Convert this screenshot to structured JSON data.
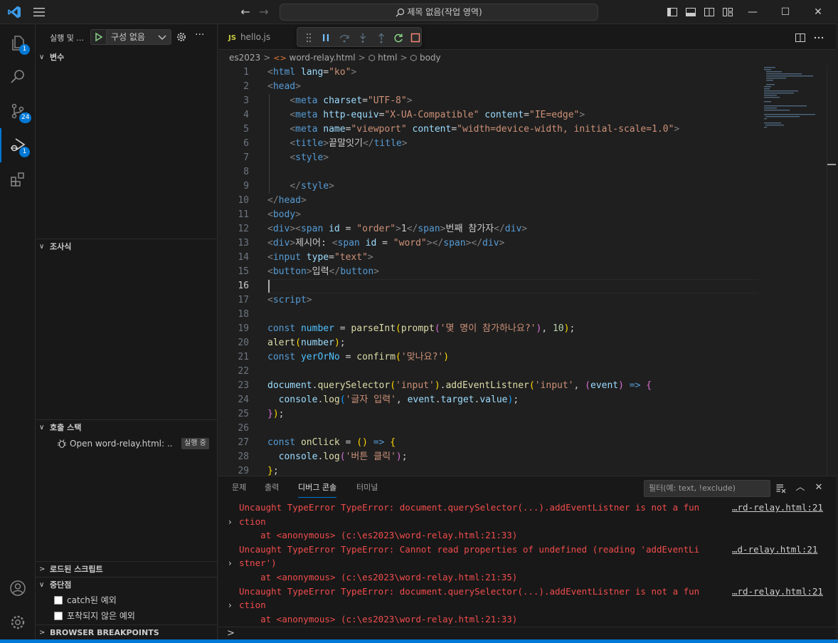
{
  "titlebar": {
    "search_label": "제목 없음(작업 영역)",
    "window_controls": [
      "minimize",
      "maximize",
      "close"
    ]
  },
  "activity": {
    "explorer_badge": "1",
    "scm_badge": "24",
    "debug_badge": "1"
  },
  "sidebar": {
    "title": "실행 및 ...",
    "config_label": "구성 없음",
    "variables_label": "변수",
    "watch_label": "조사식",
    "callstack_label": "호출 스택",
    "callstack_item": "Open word-relay.html: ...",
    "callstack_state": "실행 중",
    "loaded_scripts_label": "로드된 스크립트",
    "breakpoints_label": "중단점",
    "bp_caught": "catch된 예외",
    "bp_uncaught": "포착되지 않은 예외",
    "browser_breakpoints_label": "BROWSER BREAKPOINTS"
  },
  "editor": {
    "tab_icon": "JS",
    "tab_label": "hello.js",
    "breadcrumb": [
      "es2023",
      "word-relay.html",
      "html",
      "body"
    ],
    "line_numbers": [
      "1",
      "2",
      "3",
      "4",
      "5",
      "6",
      "7",
      "8",
      "9",
      "10",
      "11",
      "12",
      "13",
      "14",
      "15",
      "16",
      "17",
      "18",
      "19",
      "20",
      "21",
      "22",
      "23",
      "24",
      "25",
      "26",
      "27",
      "28",
      "29"
    ],
    "code": [
      [
        [
          "<",
          "p"
        ],
        [
          "html",
          "t"
        ],
        [
          " ",
          "w"
        ],
        [
          "lang",
          "a"
        ],
        [
          "=",
          "w"
        ],
        [
          "\"ko\"",
          "s"
        ],
        [
          ">",
          "p"
        ]
      ],
      [
        [
          "<",
          "p"
        ],
        [
          "head",
          "t"
        ],
        [
          ">",
          "p"
        ]
      ],
      [
        [
          "    ",
          "w"
        ],
        [
          "<",
          "p"
        ],
        [
          "meta",
          "t"
        ],
        [
          " ",
          "w"
        ],
        [
          "charset",
          "a"
        ],
        [
          "=",
          "w"
        ],
        [
          "\"UTF-8\"",
          "s"
        ],
        [
          ">",
          "p"
        ]
      ],
      [
        [
          "    ",
          "w"
        ],
        [
          "<",
          "p"
        ],
        [
          "meta",
          "t"
        ],
        [
          " ",
          "w"
        ],
        [
          "http-equiv",
          "a"
        ],
        [
          "=",
          "w"
        ],
        [
          "\"X-UA-Compatible\"",
          "s"
        ],
        [
          " ",
          "w"
        ],
        [
          "content",
          "a"
        ],
        [
          "=",
          "w"
        ],
        [
          "\"IE=edge\"",
          "s"
        ],
        [
          ">",
          "p"
        ]
      ],
      [
        [
          "    ",
          "w"
        ],
        [
          "<",
          "p"
        ],
        [
          "meta",
          "t"
        ],
        [
          " ",
          "w"
        ],
        [
          "name",
          "a"
        ],
        [
          "=",
          "w"
        ],
        [
          "\"viewport\"",
          "s"
        ],
        [
          " ",
          "w"
        ],
        [
          "content",
          "a"
        ],
        [
          "=",
          "w"
        ],
        [
          "\"width=device-width, initial-scale=1.0\"",
          "s"
        ],
        [
          ">",
          "p"
        ]
      ],
      [
        [
          "    ",
          "w"
        ],
        [
          "<",
          "p"
        ],
        [
          "title",
          "t"
        ],
        [
          ">",
          "p"
        ],
        [
          "끝말잇기",
          "w"
        ],
        [
          "</",
          "p"
        ],
        [
          "title",
          "t"
        ],
        [
          ">",
          "p"
        ]
      ],
      [
        [
          "    ",
          "w"
        ],
        [
          "<",
          "p"
        ],
        [
          "style",
          "t"
        ],
        [
          ">",
          "p"
        ]
      ],
      [
        [
          "",
          "w"
        ]
      ],
      [
        [
          "    ",
          "w"
        ],
        [
          "</",
          "p"
        ],
        [
          "style",
          "t"
        ],
        [
          ">",
          "p"
        ]
      ],
      [
        [
          "</",
          "p"
        ],
        [
          "head",
          "t"
        ],
        [
          ">",
          "p"
        ]
      ],
      [
        [
          "<",
          "p"
        ],
        [
          "body",
          "t"
        ],
        [
          ">",
          "p"
        ]
      ],
      [
        [
          "<",
          "p"
        ],
        [
          "div",
          "t"
        ],
        [
          ">",
          "p"
        ],
        [
          "<",
          "p"
        ],
        [
          "span",
          "t"
        ],
        [
          " ",
          "w"
        ],
        [
          "id",
          "a"
        ],
        [
          " = ",
          "w"
        ],
        [
          "\"order\"",
          "s"
        ],
        [
          ">",
          "p"
        ],
        [
          "1",
          "w"
        ],
        [
          "</",
          "p"
        ],
        [
          "span",
          "t"
        ],
        [
          ">",
          "p"
        ],
        [
          "번째 참가자",
          "w"
        ],
        [
          "</",
          "p"
        ],
        [
          "div",
          "t"
        ],
        [
          ">",
          "p"
        ]
      ],
      [
        [
          "<",
          "p"
        ],
        [
          "div",
          "t"
        ],
        [
          ">",
          "p"
        ],
        [
          "제시어: ",
          "w"
        ],
        [
          "<",
          "p"
        ],
        [
          "span",
          "t"
        ],
        [
          " ",
          "w"
        ],
        [
          "id",
          "a"
        ],
        [
          " = ",
          "w"
        ],
        [
          "\"word\"",
          "s"
        ],
        [
          ">",
          "p"
        ],
        [
          "</",
          "p"
        ],
        [
          "span",
          "t"
        ],
        [
          ">",
          "p"
        ],
        [
          "</",
          "p"
        ],
        [
          "div",
          "t"
        ],
        [
          ">",
          "p"
        ]
      ],
      [
        [
          "<",
          "p"
        ],
        [
          "input",
          "t"
        ],
        [
          " ",
          "w"
        ],
        [
          "type",
          "a"
        ],
        [
          "=",
          "w"
        ],
        [
          "\"text\"",
          "s"
        ],
        [
          ">",
          "p"
        ]
      ],
      [
        [
          "<",
          "p"
        ],
        [
          "button",
          "t"
        ],
        [
          ">",
          "p"
        ],
        [
          "입력",
          "w"
        ],
        [
          "</",
          "p"
        ],
        [
          "button",
          "t"
        ],
        [
          ">",
          "p"
        ]
      ],
      [
        [
          "",
          "w"
        ]
      ],
      [
        [
          "<",
          "p"
        ],
        [
          "script",
          "t"
        ],
        [
          ">",
          "p"
        ]
      ],
      [
        [
          "",
          "w"
        ]
      ],
      [
        [
          "const",
          "k"
        ],
        [
          " ",
          "w"
        ],
        [
          "number",
          "v"
        ],
        [
          " = ",
          "w"
        ],
        [
          "parseInt",
          "f"
        ],
        [
          "(",
          "y"
        ],
        [
          "prompt",
          "f"
        ],
        [
          "(",
          "m"
        ],
        [
          "'몇 명이 참가하나요?'",
          "s"
        ],
        [
          ")",
          "m"
        ],
        [
          ", ",
          "w"
        ],
        [
          "10",
          "n"
        ],
        [
          ")",
          "y"
        ],
        [
          ";",
          "w"
        ]
      ],
      [
        [
          "alert",
          "f"
        ],
        [
          "(",
          "y"
        ],
        [
          "number",
          "a"
        ],
        [
          ")",
          "y"
        ],
        [
          ";",
          "w"
        ]
      ],
      [
        [
          "const",
          "k"
        ],
        [
          " ",
          "w"
        ],
        [
          "yerOrNo",
          "v"
        ],
        [
          " = ",
          "w"
        ],
        [
          "confirm",
          "f"
        ],
        [
          "(",
          "y"
        ],
        [
          "'맞나요?'",
          "s"
        ],
        [
          ")",
          "y"
        ]
      ],
      [
        [
          "",
          "w"
        ]
      ],
      [
        [
          "document",
          "a"
        ],
        [
          ".",
          "w"
        ],
        [
          "querySelector",
          "f"
        ],
        [
          "(",
          "y"
        ],
        [
          "'input'",
          "s"
        ],
        [
          ")",
          "y"
        ],
        [
          ".",
          "w"
        ],
        [
          "addEventListner",
          "f"
        ],
        [
          "(",
          "y"
        ],
        [
          "'input'",
          "s"
        ],
        [
          ", ",
          "w"
        ],
        [
          "(",
          "m"
        ],
        [
          "event",
          "a"
        ],
        [
          ")",
          "m"
        ],
        [
          " ",
          "w"
        ],
        [
          "=>",
          "k"
        ],
        [
          " ",
          "w"
        ],
        [
          "{",
          "m"
        ]
      ],
      [
        [
          "  ",
          "w"
        ],
        [
          "console",
          "a"
        ],
        [
          ".",
          "w"
        ],
        [
          "log",
          "f"
        ],
        [
          "(",
          "b2"
        ],
        [
          "'글자 입력'",
          "s"
        ],
        [
          ", ",
          "w"
        ],
        [
          "event",
          "a"
        ],
        [
          ".",
          "w"
        ],
        [
          "target",
          "a"
        ],
        [
          ".",
          "w"
        ],
        [
          "value",
          "a"
        ],
        [
          ")",
          "b2"
        ],
        [
          ";",
          "w"
        ]
      ],
      [
        [
          "}",
          "m"
        ],
        [
          ")",
          "y"
        ],
        [
          ";",
          "w"
        ]
      ],
      [
        [
          "",
          "w"
        ]
      ],
      [
        [
          "const",
          "k"
        ],
        [
          " ",
          "w"
        ],
        [
          "onClick",
          "f"
        ],
        [
          " = ",
          "w"
        ],
        [
          "()",
          "y"
        ],
        [
          " ",
          "w"
        ],
        [
          "=>",
          "k"
        ],
        [
          " ",
          "w"
        ],
        [
          "{",
          "y"
        ]
      ],
      [
        [
          "  ",
          "w"
        ],
        [
          "console",
          "a"
        ],
        [
          ".",
          "w"
        ],
        [
          "log",
          "f"
        ],
        [
          "(",
          "m"
        ],
        [
          "'버튼 클릭'",
          "s"
        ],
        [
          ")",
          "m"
        ],
        [
          ";",
          "w"
        ]
      ],
      [
        [
          "}",
          "y"
        ],
        [
          ";",
          "w"
        ]
      ]
    ]
  },
  "panel": {
    "tabs": [
      "문제",
      "출력",
      "디버그 콘솔",
      "터미널"
    ],
    "filter_placeholder": "필터(예: text, !exclude)",
    "console": [
      {
        "text": "Uncaught TypeError TypeError: document.querySelector(...).addEventListner is not a fun",
        "source": "…rd-relay.html:21",
        "kind": "error"
      },
      {
        "text": "ction",
        "kind": "error-cont",
        "chevron": true
      },
      {
        "text": "    at <anonymous> (c:\\es2023\\word-relay.html:21:33)",
        "kind": "error"
      },
      {
        "text": "Uncaught TypeError TypeError: Cannot read properties of undefined (reading 'addEventLi",
        "source": "…d-relay.html:21",
        "kind": "error"
      },
      {
        "text": "stner')",
        "kind": "error-cont",
        "chevron": true
      },
      {
        "text": "    at <anonymous> (c:\\es2023\\word-relay.html:21:35)",
        "kind": "error"
      },
      {
        "text": "Uncaught TypeError TypeError: document.querySelector(...).addEventListner is not a fun",
        "source": "…rd-relay.html:21",
        "kind": "error"
      },
      {
        "text": "ction",
        "kind": "error-cont",
        "chevron": true
      },
      {
        "text": "    at <anonymous> (c:\\es2023\\word-relay.html:21:33)",
        "kind": "error"
      }
    ],
    "prompt": ">"
  }
}
